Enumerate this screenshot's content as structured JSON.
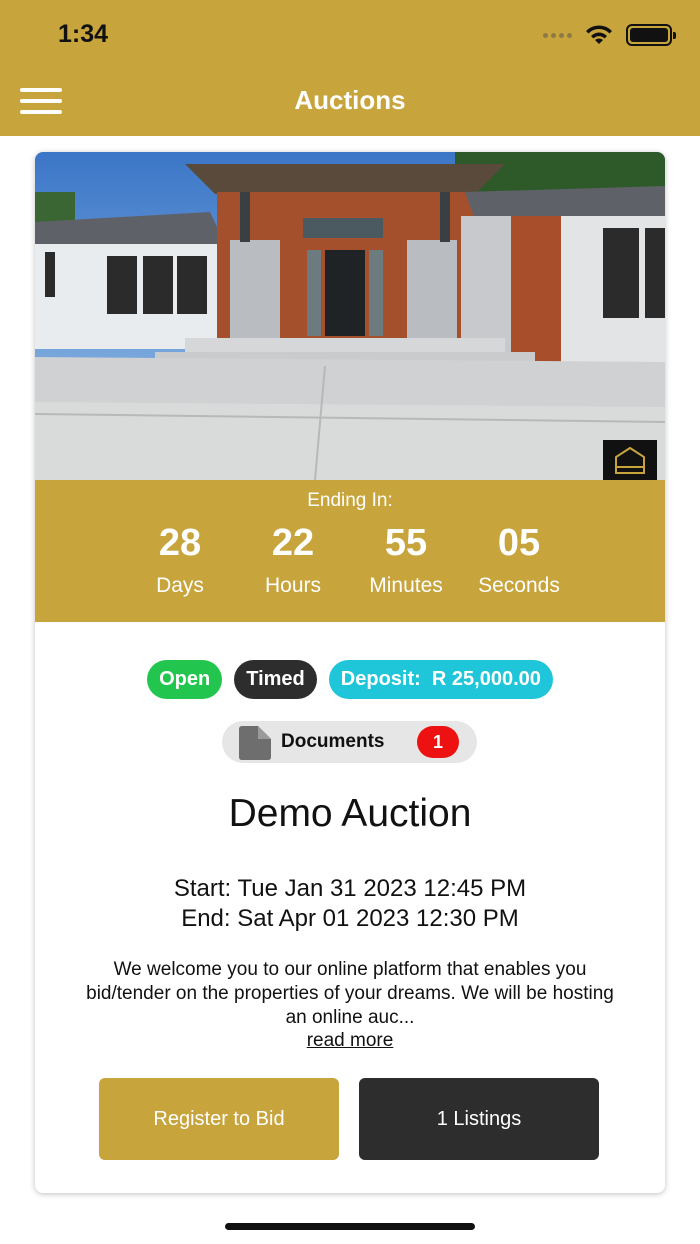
{
  "status_bar": {
    "time": "1:34"
  },
  "nav": {
    "title": "Auctions"
  },
  "colors": {
    "accent": "#c7a43c",
    "open": "#22c54e",
    "timed": "#2d2d2d",
    "deposit": "#1fc5d8",
    "badge": "#ee1111"
  },
  "countdown": {
    "label": "Ending In:",
    "units": [
      {
        "value": "28",
        "label": "Days"
      },
      {
        "value": "22",
        "label": "Hours"
      },
      {
        "value": "55",
        "label": "Minutes"
      },
      {
        "value": "05",
        "label": "Seconds"
      }
    ]
  },
  "tags": {
    "open": "Open",
    "timed": "Timed",
    "deposit": "Deposit:  R 25,000.00"
  },
  "documents": {
    "label": "Documents",
    "count": "1",
    "icon": "document-icon"
  },
  "auction": {
    "title": "Demo Auction",
    "start": "Start: Tue Jan 31 2023 12:45 PM",
    "end": "End: Sat Apr 01 2023 12:30 PM",
    "description": "We welcome you to our online platform that enables you bid/tender on the properties of your dreams. We will be hosting an online auc...",
    "read_more": "read more"
  },
  "actions": {
    "register": "Register to Bid",
    "listings": "1 Listings"
  }
}
